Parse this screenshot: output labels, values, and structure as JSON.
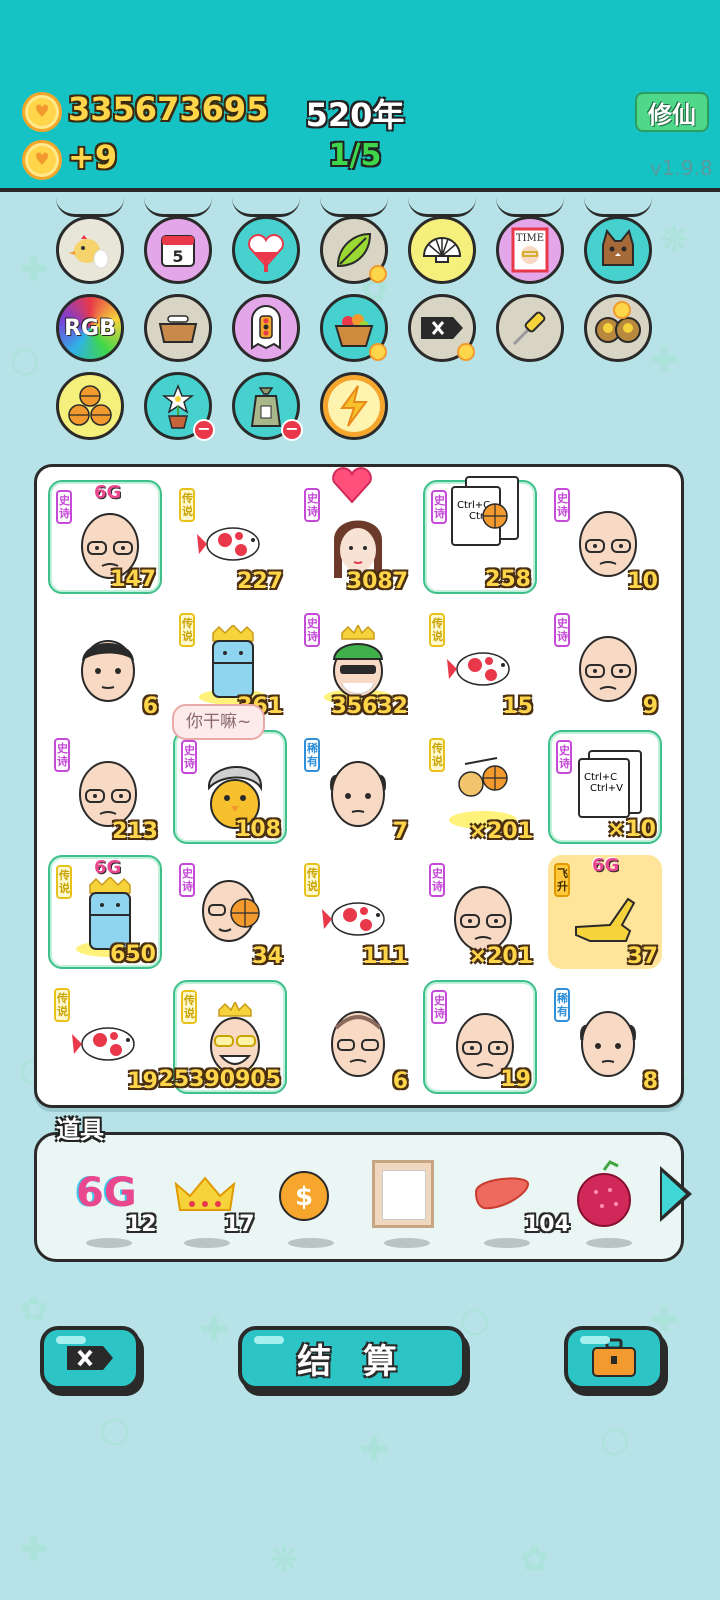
{
  "header": {
    "coins": "335673695",
    "coin_delta": "+9",
    "year": "520年",
    "progress": "1/5",
    "xiuxian_label": "修仙",
    "version": "v1.9.8"
  },
  "badges": [
    {
      "icon": "chick-egg-icon"
    },
    {
      "icon": "calendar-icon",
      "label": "5"
    },
    {
      "icon": "heart-fan-icon"
    },
    {
      "icon": "leaf-icon"
    },
    {
      "icon": "shell-icon"
    },
    {
      "icon": "time-magazine-icon",
      "label": "TIME"
    },
    {
      "icon": "cat-icon"
    },
    {
      "icon": "rgb-icon",
      "label": "RGB"
    },
    {
      "icon": "bone-bowl-icon"
    },
    {
      "icon": "traffic-light-ghost-icon"
    },
    {
      "icon": "fruit-basket-icon"
    },
    {
      "icon": "delete-key-icon"
    },
    {
      "icon": "screwdriver-icon"
    },
    {
      "icon": "owls-icon"
    },
    {
      "icon": "basketballs-icon"
    },
    {
      "icon": "flower-pot-icon"
    },
    {
      "icon": "trash-bag-icon"
    },
    {
      "icon": "lightning-icon"
    }
  ],
  "board": {
    "speech": "你干嘛~",
    "rows": [
      [
        {
          "tag": "史诗",
          "art": "bald-man-face",
          "num": "147",
          "badge": "6G"
        },
        {
          "tag": "传说",
          "art": "koi-fish",
          "num": "227"
        },
        {
          "tag": "史诗",
          "art": "girl-with-heart",
          "num": "3087"
        },
        {
          "tag": "史诗",
          "art": "ctrl-c-cards",
          "num": "258",
          "card1": "Ctrl+C",
          "card2": "Ctrl"
        },
        {
          "tag": "史诗",
          "art": "bald-man-face",
          "num": "10"
        }
      ],
      [
        {
          "tag": "",
          "art": "young-man-face",
          "num": "6"
        },
        {
          "tag": "传说",
          "art": "crowned-fridge",
          "num": "361"
        },
        {
          "tag": "史诗",
          "art": "crowned-green-cap-man",
          "num": "35632"
        },
        {
          "tag": "传说",
          "art": "koi-fish",
          "num": "15"
        },
        {
          "tag": "史诗",
          "art": "bald-man-face",
          "num": "9"
        }
      ],
      [
        {
          "tag": "史诗",
          "art": "bald-man-face",
          "num": "213"
        },
        {
          "tag": "史诗",
          "art": "grey-hair-chick",
          "num": "108"
        },
        {
          "tag": "稀有",
          "art": "bald-man-face",
          "num": "7"
        },
        {
          "tag": "传说",
          "art": "fruit-basketball",
          "num": "×201"
        },
        {
          "tag": "史诗",
          "art": "ctrl-c-v-cards",
          "num": "×10",
          "card1": "Ctrl+C",
          "card2": "Ctrl+V"
        }
      ],
      [
        {
          "tag": "传说",
          "art": "crowned-fridge",
          "num": "650",
          "badge": "6G"
        },
        {
          "tag": "史诗",
          "art": "man-with-basketball",
          "num": "34"
        },
        {
          "tag": "传说",
          "art": "koi-fish",
          "num": "111"
        },
        {
          "tag": "史诗",
          "art": "bald-man-face",
          "num": "×201"
        },
        {
          "tag": "飞升",
          "art": "pointing-hand",
          "num": "37",
          "badge": "6G"
        }
      ],
      [
        {
          "tag": "传说",
          "art": "koi-fish",
          "num": "19"
        },
        {
          "tag": "传说",
          "art": "crowned-laughing-man",
          "num": "25390905"
        },
        {
          "tag": "",
          "art": "old-man-face",
          "num": "6"
        },
        {
          "tag": "史诗",
          "art": "bald-man-face",
          "num": "19"
        },
        {
          "tag": "稀有",
          "art": "bald-man-face",
          "num": "8"
        }
      ]
    ]
  },
  "props": {
    "label": "道具",
    "items": [
      {
        "name": "6G",
        "count": "12"
      },
      {
        "name": "crown",
        "count": "17"
      },
      {
        "name": "dollar-coin",
        "count": ""
      },
      {
        "name": "picture-frame",
        "count": ""
      },
      {
        "name": "liver",
        "count": "104"
      },
      {
        "name": "lychee",
        "count": ""
      }
    ]
  },
  "buttons": {
    "settle": "结 算"
  }
}
